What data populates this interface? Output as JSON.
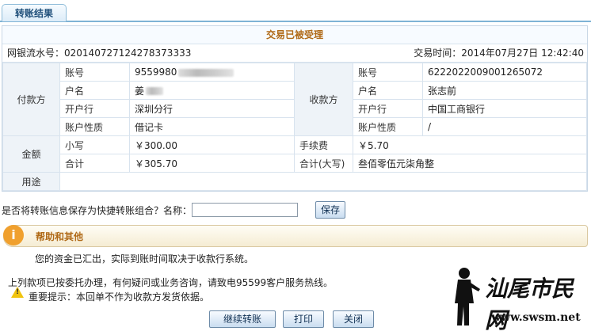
{
  "tab": {
    "label": "转账结果"
  },
  "result": {
    "status": "交易已被受理",
    "serial_label": "网银流水号：",
    "serial": "020140727124278373333",
    "time_label": "交易时间：",
    "time": "2014年07月27日 12:42:40"
  },
  "payer": {
    "section": "付款方",
    "account_label": "账号",
    "account": "9559980",
    "name_label": "户名",
    "name": "姜",
    "bank_label": "开户行",
    "bank": "深圳分行",
    "type_label": "账户性质",
    "type": "借记卡"
  },
  "payee": {
    "section": "收款方",
    "account_label": "账号",
    "account": "6222022009001265072",
    "name_label": "户名",
    "name": "张志前",
    "bank_label": "开户行",
    "bank": "中国工商银行",
    "type_label": "账户性质",
    "type": "/"
  },
  "amount": {
    "section": "金额",
    "small_label": "小写",
    "small": "￥300.00",
    "fee_label": "手续费",
    "fee": "￥5.70",
    "total_label": "合计",
    "total": "￥305.70",
    "total_cap_label": "合计(大写)",
    "total_cap": "叁佰零伍元柒角整"
  },
  "usage": {
    "label": "用途",
    "value": ""
  },
  "save": {
    "prompt": "是否将转账信息保存为快捷转账组合？名称：",
    "input_value": "",
    "button": "保存"
  },
  "help": {
    "title": "帮助和其他",
    "line1": "您的资金已汇出，实际到账时间取决于收款行系统。",
    "line2": "上列款项已按委托办理，有何疑问或业务咨询，请致电95599客户服务热线。",
    "line3": "重要提示：本回单不作为收款方发货依据。"
  },
  "buttons": {
    "continue": "继续转账",
    "print": "打印",
    "close": "关闭"
  },
  "watermark": {
    "cn": "汕尾市民网",
    "url": "www.swsm.net"
  }
}
